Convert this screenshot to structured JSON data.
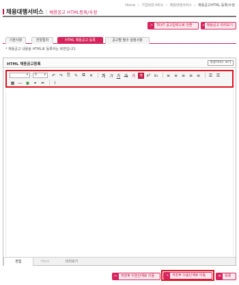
{
  "breadcrumb": {
    "home": "Home",
    "level1": "기업회원서비스",
    "level2": "채용대행서비스",
    "current": "채용공고HTML 등록/수정",
    "separator": "›"
  },
  "header": {
    "title": "채용대행서비스",
    "subtitle": "채용공고 HTML등록/수정"
  },
  "top_buttons": {
    "text_switch": "TEXT 공고입력으로 전환",
    "preview": "채용공고 미리보기",
    "icon": "→"
  },
  "tabs": [
    {
      "label": "기본사항"
    },
    {
      "label": "전형절차"
    },
    {
      "label": "HTML 채용공고 등록"
    },
    {
      "label": "공고별 필수 설정사항"
    }
  ],
  "description": "* 채용공고 내용을 HTML로 등록하는 화면입니다.",
  "panel": {
    "title": "HTML 채용공고등록",
    "guide_button": "작성가이드 보기"
  },
  "toolbar": {
    "font_select": "",
    "size_select": "0",
    "select_arrow": "▾",
    "row1": [
      "↶",
      "↷",
      "⎘",
      "✎",
      "⧉",
      "✕",
      "가",
      "가",
      "가",
      "가",
      "가",
      "가",
      "x²",
      "x₂",
      "≡",
      "≡",
      "≡",
      "≡",
      "≡",
      "☰",
      "☰"
    ],
    "row2": [
      "▦",
      "―",
      "▣",
      "⚭",
      "⚮",
      "Ⅰ"
    ]
  },
  "editor_modes": {
    "edit": "편집",
    "html": "Html",
    "preview": "미리보기"
  },
  "bottom_buttons": {
    "prev_step": "저장후 이전단계로 이동",
    "next_step": "저장후 다음단계로 이동",
    "list": "목록",
    "prev_icon": "←",
    "next_icon": "→",
    "list_icon": "≡"
  },
  "colors": {
    "accent": "#d6245c",
    "highlight_box": "#e0101b"
  }
}
